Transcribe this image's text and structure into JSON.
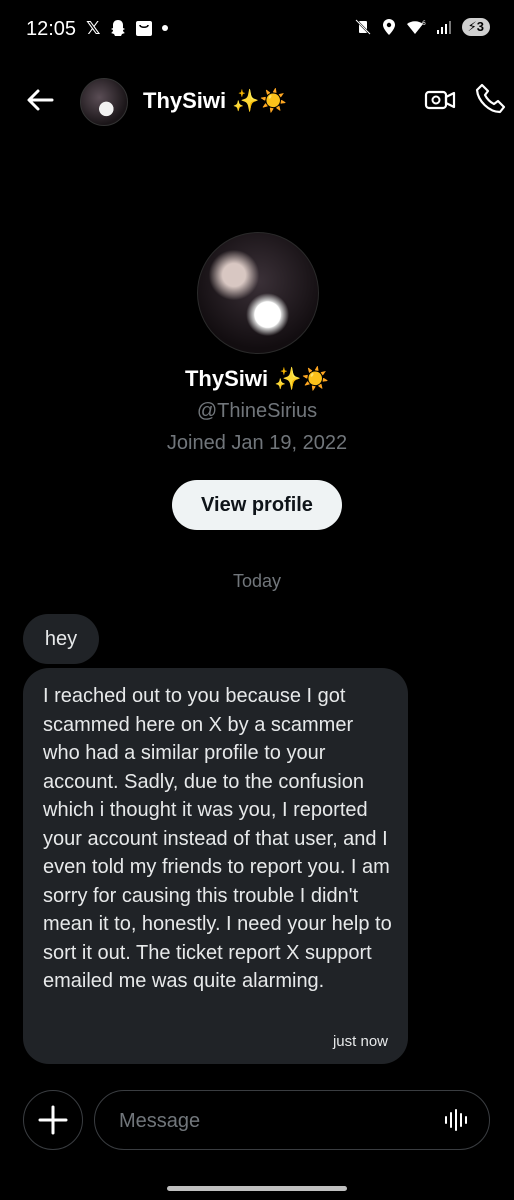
{
  "status_bar": {
    "time": "12:05",
    "battery": "3",
    "left_icons": [
      "x-logo-icon",
      "snapchat-icon",
      "shopping-bag-icon",
      "dot-icon"
    ],
    "right_icons": [
      "mute-vibrate-icon",
      "location-icon",
      "wifi-6-icon",
      "signal-icon",
      "battery-icon"
    ]
  },
  "header": {
    "title": "ThySiwi ✨☀️",
    "back_icon": "arrow-left-icon",
    "video_icon": "video-camera-icon",
    "call_icon": "phone-icon"
  },
  "profile": {
    "name": "ThySiwi ✨☀️",
    "handle": "@ThineSirius",
    "joined": "Joined Jan 19, 2022",
    "view_profile_label": "View profile"
  },
  "conversation": {
    "day_label": "Today",
    "messages": [
      {
        "text": "hey"
      },
      {
        "text": "I reached out to you because I got scammed here on X by a scammer who had a similar profile to your account. Sadly, due to the confusion which i thought it was you, I reported your account instead of that user, and I even told my friends to report you. I am sorry for causing this trouble I didn't mean it to, honestly. I need your help to sort it out. The ticket report X support emailed me was quite alarming.",
        "time": "just now"
      }
    ]
  },
  "composer": {
    "placeholder": "Message",
    "add_icon": "plus-icon",
    "voice_icon": "voice-waveform-icon"
  },
  "colors": {
    "background": "#000000",
    "bubble": "#202327",
    "muted_text": "#71767b",
    "button_bg": "#eff3f4"
  }
}
